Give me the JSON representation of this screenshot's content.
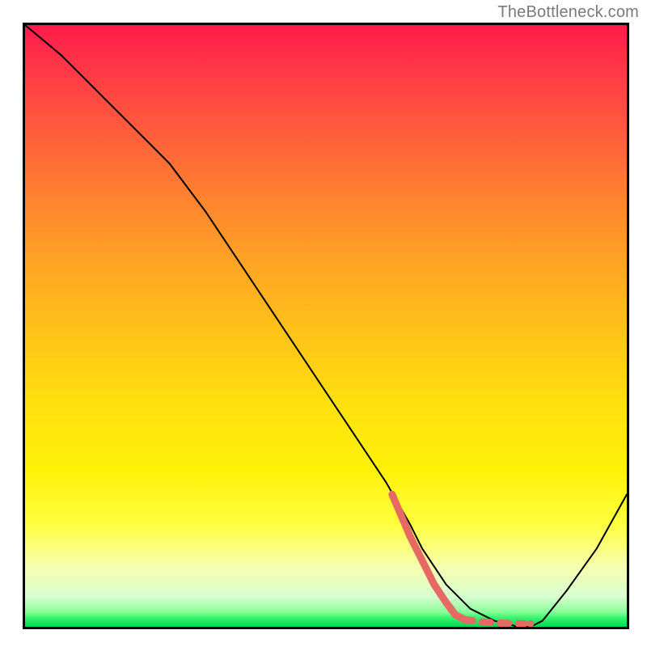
{
  "attribution": "TheBottleneck.com",
  "chart_data": {
    "type": "line",
    "title": "",
    "xlabel": "",
    "ylabel": "",
    "xlim": [
      0,
      100
    ],
    "ylim": [
      0,
      100
    ],
    "series": [
      {
        "name": "main-curve",
        "color": "#000000",
        "stroke_width": 2,
        "x": [
          0,
          6,
          12,
          18,
          24,
          30,
          36,
          42,
          48,
          54,
          60,
          64,
          66,
          70,
          74,
          78,
          82,
          84,
          86,
          90,
          95,
          100
        ],
        "y": [
          100,
          95,
          89,
          83,
          77,
          69,
          60,
          51,
          42,
          33,
          24,
          17,
          13,
          7,
          3,
          1,
          0,
          0,
          1,
          6,
          13,
          22
        ]
      },
      {
        "name": "highlight-band",
        "color": "#e46a63",
        "stroke_width": 9,
        "dash": false,
        "x": [
          61,
          64,
          66,
          68,
          70,
          71.5,
          73
        ],
        "y": [
          22,
          15,
          11,
          7,
          4,
          2,
          1.2
        ]
      },
      {
        "name": "highlight-flat",
        "color": "#e46a63",
        "stroke_width": 9,
        "dash": true,
        "x": [
          73,
          76,
          79,
          82,
          84
        ],
        "y": [
          1.2,
          0.8,
          0.6,
          0.5,
          0.5
        ]
      }
    ]
  }
}
